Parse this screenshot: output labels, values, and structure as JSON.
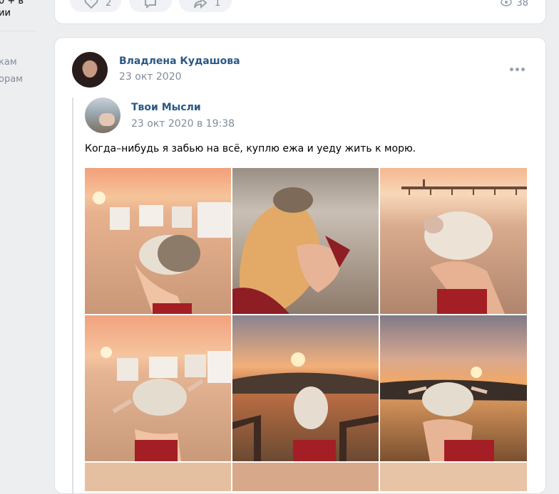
{
  "sidebar": {
    "line1": "0 + в",
    "line2": "ии",
    "link1": "кам",
    "link2": "орам"
  },
  "prev_post": {
    "likes_count": "2",
    "shares_count": "1",
    "views_count": "38"
  },
  "post": {
    "author": "Владлена Кудашова",
    "date": "23 окт 2020",
    "more_icon": "more-dots-icon",
    "repost": {
      "source_name": "Твои Мысли",
      "source_date": "23 окт 2020 в 19:38",
      "text": "Когда–нибудь я забью на всё, куплю ежа и уеду жить к морю.",
      "photos": [
        "hedgehog-beach-chairs-sunset",
        "girl-hedgehog-on-head",
        "hedgehog-pier-sea",
        "hedgehog-arms-spread-beach",
        "hedgehog-stairs-sunset",
        "hedgehog-hand-field-sunset"
      ]
    }
  },
  "colors": {
    "link": "#2a5885",
    "secondary": "#818c99",
    "background": "#edeef0",
    "card": "#ffffff"
  }
}
